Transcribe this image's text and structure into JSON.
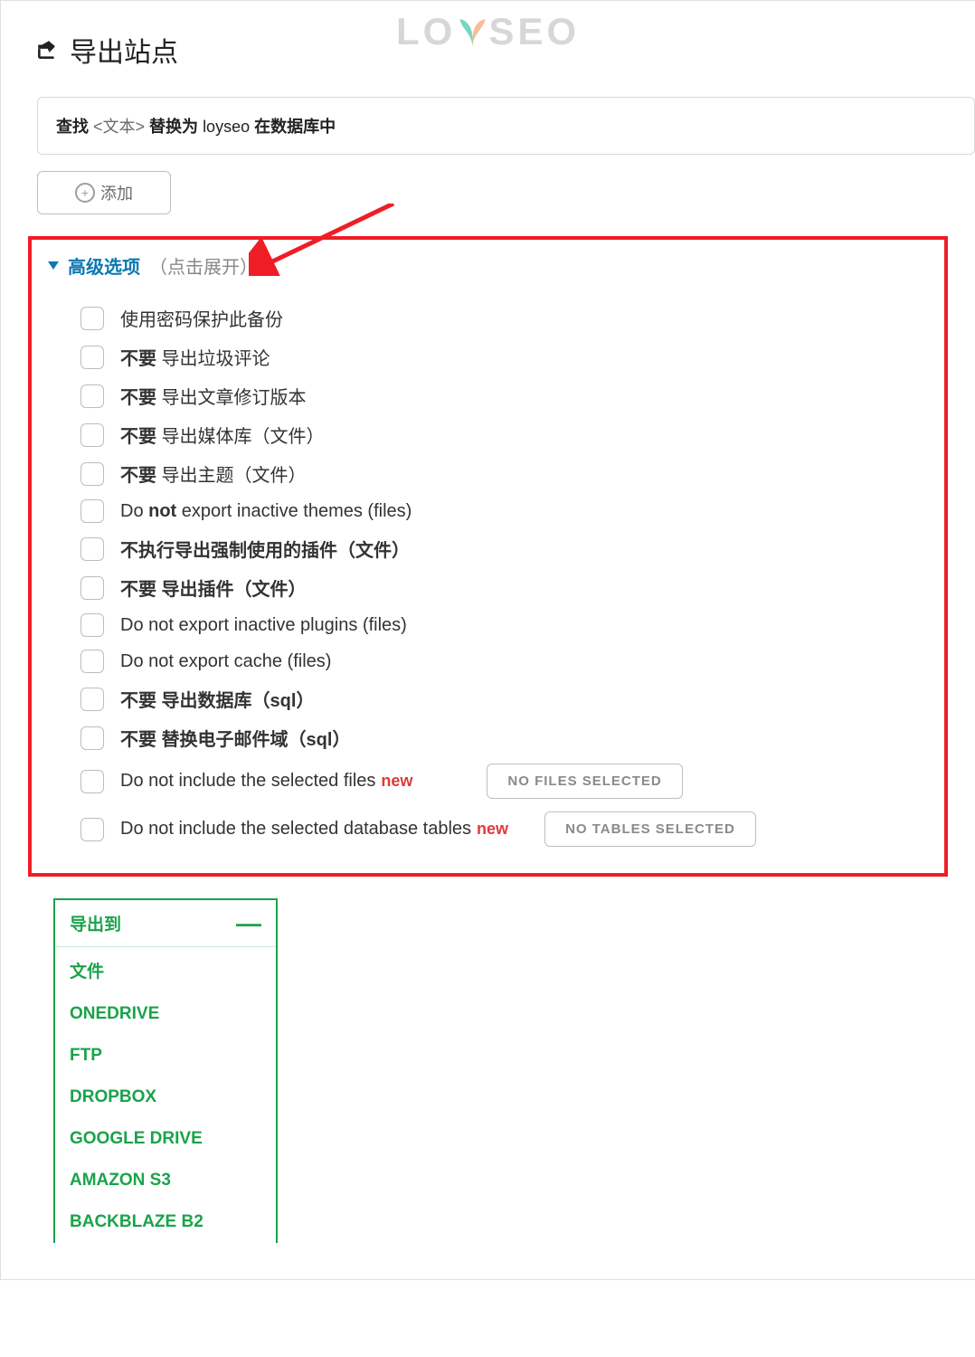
{
  "header": {
    "title": "导出站点"
  },
  "watermark": {
    "left": "LO",
    "right": "SEO"
  },
  "find": {
    "prefix_bold": "查找",
    "mid_light": " <文本> ",
    "replace_bold": "替换为",
    "replace_val": " loyseo ",
    "in_bold": "在数据库中"
  },
  "add_button": "添加",
  "advanced": {
    "title": "高级选项",
    "hint": "（点击展开）"
  },
  "options": [
    {
      "segments": [
        {
          "t": "使用密码保护此备份",
          "b": false
        }
      ]
    },
    {
      "segments": [
        {
          "t": "不要",
          "b": true
        },
        {
          "t": " 导出垃圾评论",
          "b": false
        }
      ]
    },
    {
      "segments": [
        {
          "t": "不要",
          "b": true
        },
        {
          "t": " 导出文章修订版本",
          "b": false
        }
      ]
    },
    {
      "segments": [
        {
          "t": "不要",
          "b": true
        },
        {
          "t": " 导出媒体库（文件）",
          "b": false
        }
      ]
    },
    {
      "segments": [
        {
          "t": "不要",
          "b": true
        },
        {
          "t": " 导出主题（文件）",
          "b": false
        }
      ]
    },
    {
      "segments": [
        {
          "t": "Do ",
          "b": false
        },
        {
          "t": "not",
          "b": true
        },
        {
          "t": " export inactive themes (files)",
          "b": false
        }
      ]
    },
    {
      "segments": [
        {
          "t": "不执行导出强制使用的插件（文件）",
          "b": true
        }
      ]
    },
    {
      "segments": [
        {
          "t": "不要 导出插件（文件）",
          "b": true
        }
      ]
    },
    {
      "segments": [
        {
          "t": "Do not export inactive plugins (files)",
          "b": false
        }
      ]
    },
    {
      "segments": [
        {
          "t": "Do not export cache (files)",
          "b": false
        }
      ]
    },
    {
      "segments": [
        {
          "t": "不要 导出数据库（sql）",
          "b": true
        }
      ]
    },
    {
      "segments": [
        {
          "t": "不要 替换电子邮件域（sql）",
          "b": true
        }
      ]
    },
    {
      "segments": [
        {
          "t": "Do not include the selected files",
          "b": false
        }
      ],
      "new": "new",
      "button": "NO FILES SELECTED"
    },
    {
      "segments": [
        {
          "t": "Do not include the selected database tables",
          "b": false
        }
      ],
      "new": "new",
      "button": "NO TABLES SELECTED"
    }
  ],
  "export": {
    "title": "导出到",
    "destinations": [
      "文件",
      "ONEDRIVE",
      "FTP",
      "DROPBOX",
      "GOOGLE DRIVE",
      "AMAZON S3",
      "BACKBLAZE B2"
    ]
  }
}
